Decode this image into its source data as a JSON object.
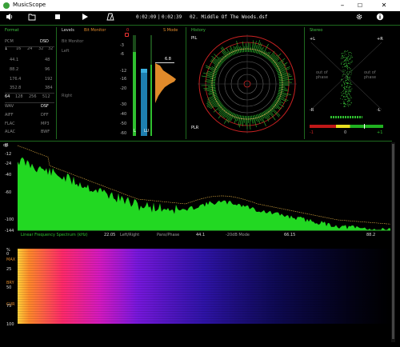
{
  "window": {
    "title": "MusicScope",
    "min": "–",
    "max": "☐",
    "close": "✕"
  },
  "toolbar": {
    "elapsed": "0:02:09",
    "separator": "|",
    "total": "0:02:39",
    "track": "02. Middle Of The Woods.dsf",
    "icons": [
      "volume-icon",
      "folder-icon",
      "stop-icon",
      "play-icon",
      "metronome-icon",
      "settings-icon",
      "info-icon"
    ]
  },
  "format_panel": {
    "title": "Format",
    "rows": [
      [
        "PCM",
        "",
        "",
        "DSD"
      ],
      [
        "1",
        "16",
        "24",
        "32",
        "32"
      ],
      [
        "44.1",
        "",
        "",
        "",
        "48"
      ],
      [
        "88.2",
        "",
        "",
        "",
        "96"
      ],
      [
        "176.4",
        "",
        "",
        "",
        "192"
      ],
      [
        "352.8",
        "",
        "",
        "",
        "384"
      ],
      [
        "64",
        "128",
        "256",
        "512"
      ],
      [
        "WAV",
        "",
        "",
        "DSF"
      ],
      [
        "AIFF",
        "",
        "",
        "DFF"
      ],
      [
        "FLAC",
        "",
        "",
        "MP3"
      ],
      [
        "ALAC",
        "",
        "",
        "BWF"
      ]
    ]
  },
  "levels_panel": {
    "title": "Levels",
    "mode": "Bit Monitor",
    "sub": "Bit Monitor",
    "left": "Left",
    "right": "Right"
  },
  "meter": {
    "top_label": "0",
    "mode": "S Mode",
    "scale": [
      "-3",
      "-6",
      "-12",
      "-16",
      "-20",
      "-30",
      "-40",
      "-50",
      "-60"
    ],
    "peak_value": "6.8",
    "bottom_left": "L",
    "bottom_right": "LU",
    "left_level": 0.83,
    "right_level": 0.71
  },
  "history_panel": {
    "title": "History",
    "pil": "PIL",
    "plr": "PLR"
  },
  "stereo_panel": {
    "title": "Stereo",
    "plus_l": "+L",
    "plus_r": "+R",
    "minus_r": "-R",
    "minus_l": "-L",
    "out_left": "out of phase",
    "out_right": "out of phase",
    "corr_left": "-1",
    "corr_mid": "0",
    "corr_right": "+1"
  },
  "spectrum": {
    "db_labels": [
      "dB",
      "0",
      "-12",
      "-24",
      "-40",
      "-60",
      "-100",
      "-144"
    ],
    "x_labels": [
      "22.05",
      "44.1",
      "66.15",
      "88.2"
    ],
    "legend": [
      "Linear Frequency Spectrum (kHz)",
      "Left/Right",
      "Pans/Phase",
      "-20dB Mode"
    ]
  },
  "sonogram": {
    "y_labels": [
      "%",
      "0",
      "25",
      "50",
      "75",
      "100"
    ],
    "side_labels": [
      "MAX",
      "BRY",
      "CUR"
    ]
  },
  "colors": {
    "accent_green": "#3fc23f",
    "accent_orange": "#e08a2a",
    "spectrum_fill": "#22d822"
  }
}
